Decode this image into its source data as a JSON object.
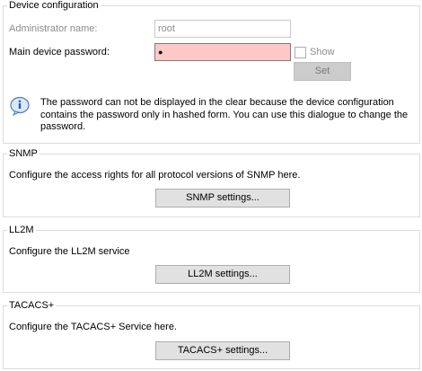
{
  "device_config": {
    "title": "Device configuration",
    "admin_name_label": "Administrator name:",
    "admin_name_value": "root",
    "password_label": "Main device password:",
    "password_value": "●",
    "show_label": "Show",
    "set_label": "Set",
    "info_text_line1": "The password can not be displayed in the clear because the device configuration",
    "info_text_line2": "contains the password only in hashed form. You can use this dialogue to change the",
    "info_text_line3": "password."
  },
  "snmp": {
    "title": "SNMP",
    "description": "Configure the access rights for all protocol versions of SNMP here.",
    "button_label": "SNMP settings..."
  },
  "ll2m": {
    "title": "LL2M",
    "description": "Configure the LL2M service",
    "button_label": "LL2M settings..."
  },
  "tacacs": {
    "title": "TACACS+",
    "description": "Configure the TACACS+ Service here.",
    "button_label": "TACACS+ settings..."
  },
  "colors": {
    "password_field_bg": "#ffc8c8",
    "info_icon": "#4a7ec0"
  },
  "icons": {
    "info": "info-icon"
  }
}
